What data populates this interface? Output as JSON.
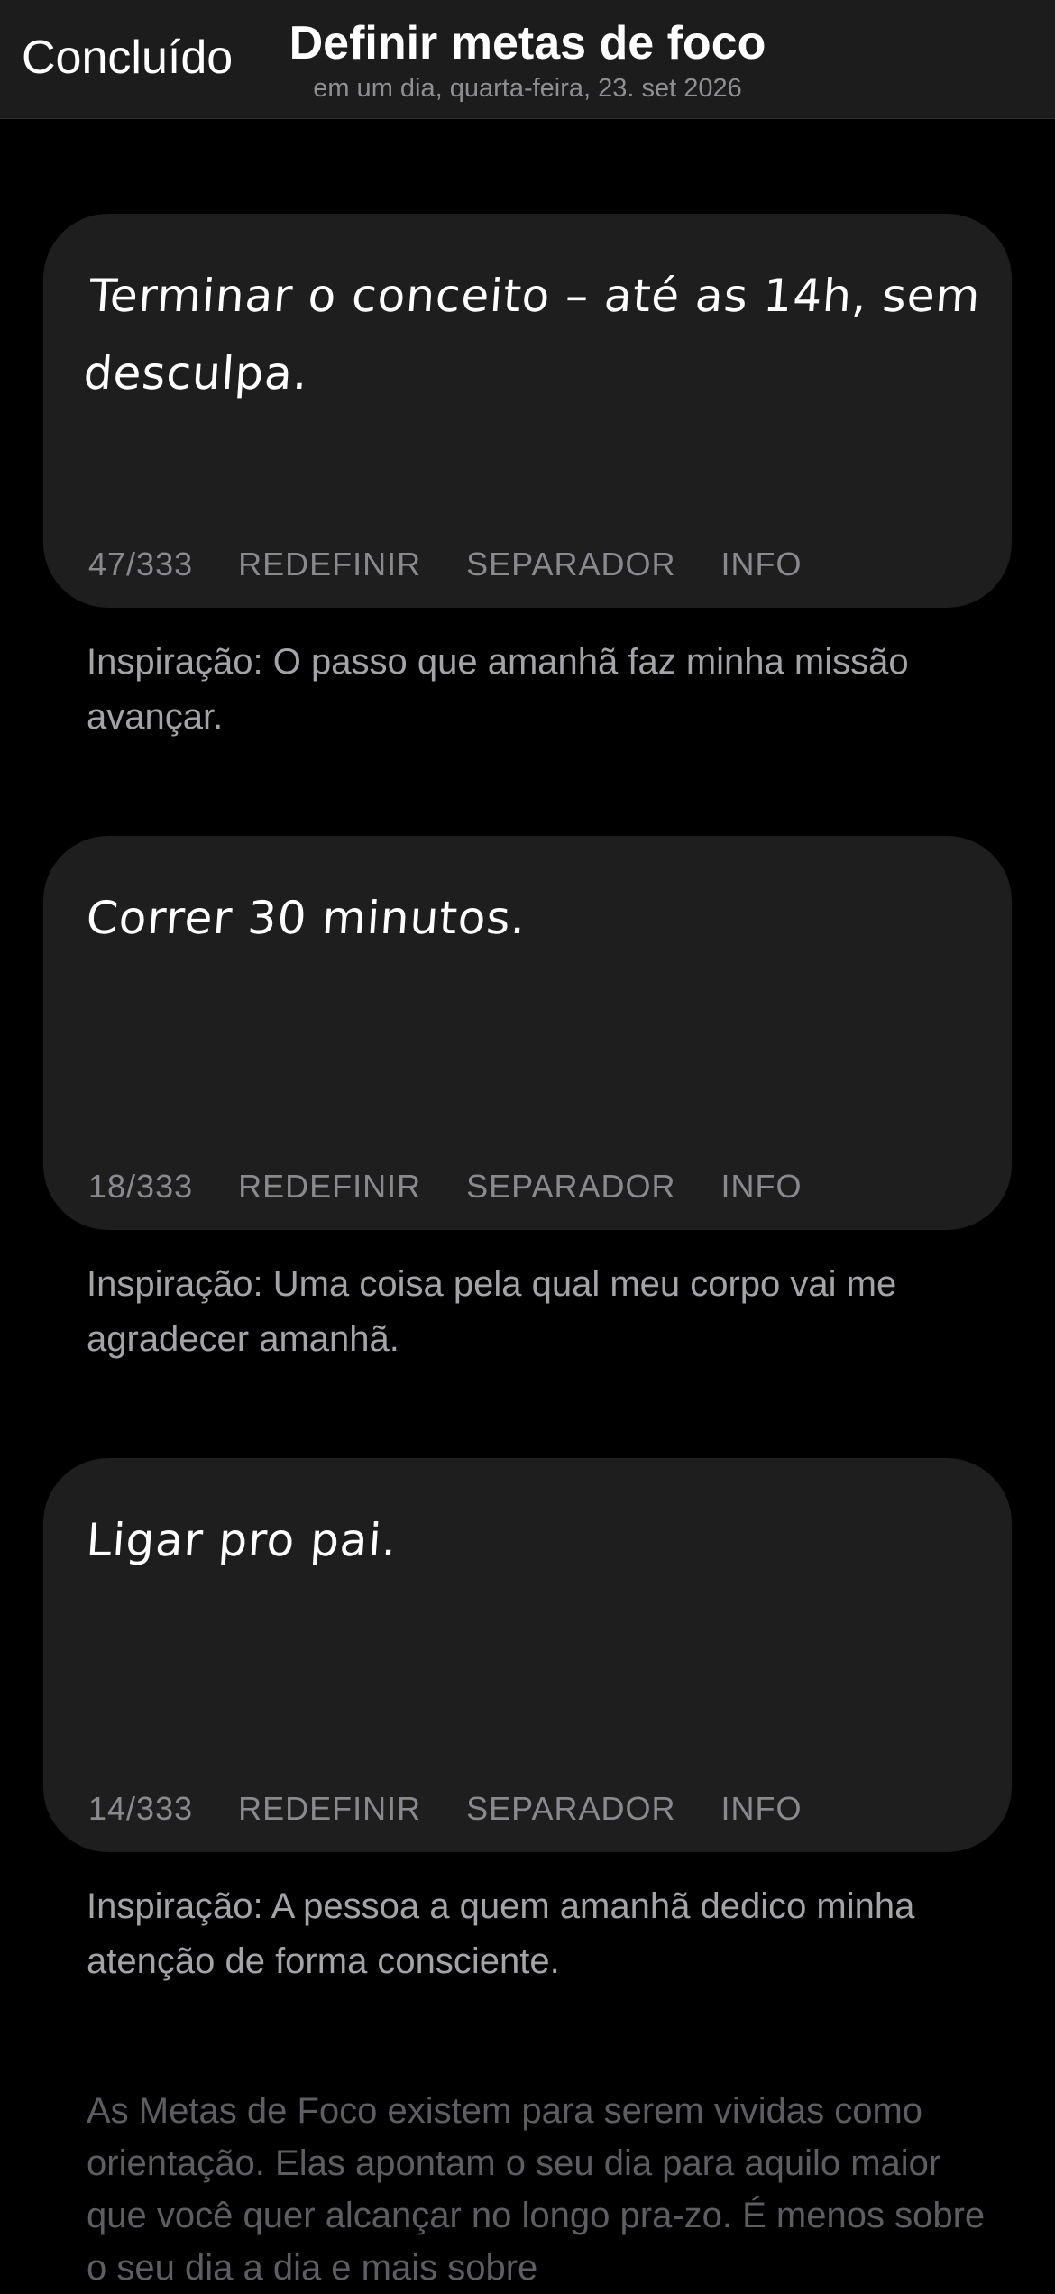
{
  "header": {
    "done_label": "Concluído",
    "title": "Definir metas de foco",
    "subtitle": "em um dia, quarta-feira, 23. set 2026"
  },
  "goals": [
    {
      "text": "Terminar o conceito – até as 14h, sem desculpa.",
      "counter": "47/333",
      "reset_label": "REDEFINIR",
      "separator_label": "SEPARADOR",
      "info_label": "INFO",
      "inspiration": "Inspiração: O passo que amanhã faz minha missão avançar."
    },
    {
      "text": "Correr 30 minutos.",
      "counter": "18/333",
      "reset_label": "REDEFINIR",
      "separator_label": "SEPARADOR",
      "info_label": "INFO",
      "inspiration": "Inspiração: Uma coisa pela qual meu corpo vai me agradecer amanhã."
    },
    {
      "text": "Ligar pro pai.",
      "counter": "14/333",
      "reset_label": "REDEFINIR",
      "separator_label": "SEPARADOR",
      "info_label": "INFO",
      "inspiration": "Inspiração: A pessoa a quem amanhã dedico minha atenção de forma consciente."
    }
  ],
  "footer": {
    "about_text": "As Metas de Foco existem para serem vividas como orientação. Elas apontam o seu dia para aquilo maior que você quer alcançar no longo pra-zo. É menos sobre o seu dia a dia e mais sobre"
  },
  "colors": {
    "background": "#000000",
    "nav_background": "#1c1c1c",
    "card_background": "#1e1e1e",
    "secondary_text": "#8a8a8e"
  }
}
